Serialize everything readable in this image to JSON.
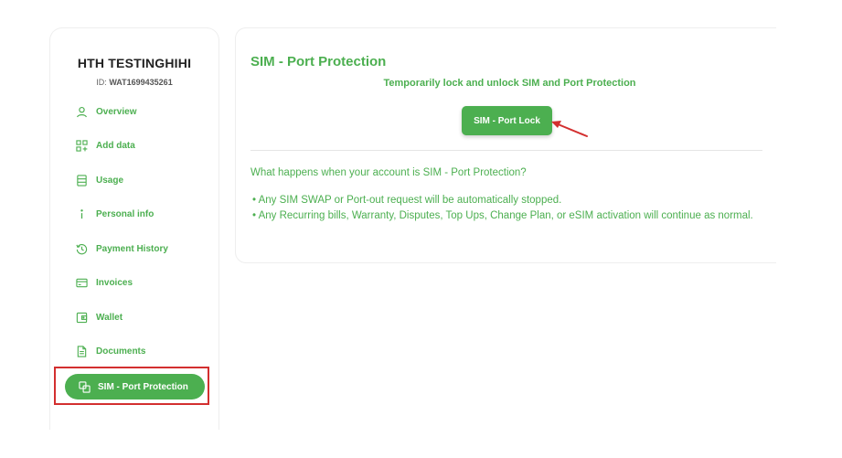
{
  "account": {
    "name": "HTH TESTINGHIHI",
    "id_label": "ID:",
    "id_value": "WAT1699435261"
  },
  "sidebar": {
    "items": [
      {
        "label": "Overview",
        "icon": "user-icon"
      },
      {
        "label": "Add data",
        "icon": "grid-plus-icon"
      },
      {
        "label": "Usage",
        "icon": "document-lines-icon"
      },
      {
        "label": "Personal info",
        "icon": "info-icon"
      },
      {
        "label": "Payment History",
        "icon": "history-clock-icon"
      },
      {
        "label": "Invoices",
        "icon": "card-icon"
      },
      {
        "label": "Wallet",
        "icon": "wallet-icon"
      },
      {
        "label": "Documents",
        "icon": "file-icon"
      },
      {
        "label": "SIM - Port Protection",
        "icon": "copy-squares-icon",
        "active": true
      }
    ]
  },
  "panel": {
    "title": "SIM - Port Protection",
    "subtitle": "Temporarily lock and unlock SIM and Port Protection",
    "button_label": "SIM - Port Lock",
    "question": "What happens when your account is SIM - Port Protection?",
    "bullets": [
      "Any SIM SWAP or Port-out request will be automatically stopped.",
      "Any Recurring bills, Warranty, Disputes, Top Ups, Change Plan, or eSIM activation will continue as normal."
    ]
  },
  "colors": {
    "brand_green": "#4caf50",
    "annotation_red": "#d32f2f"
  }
}
